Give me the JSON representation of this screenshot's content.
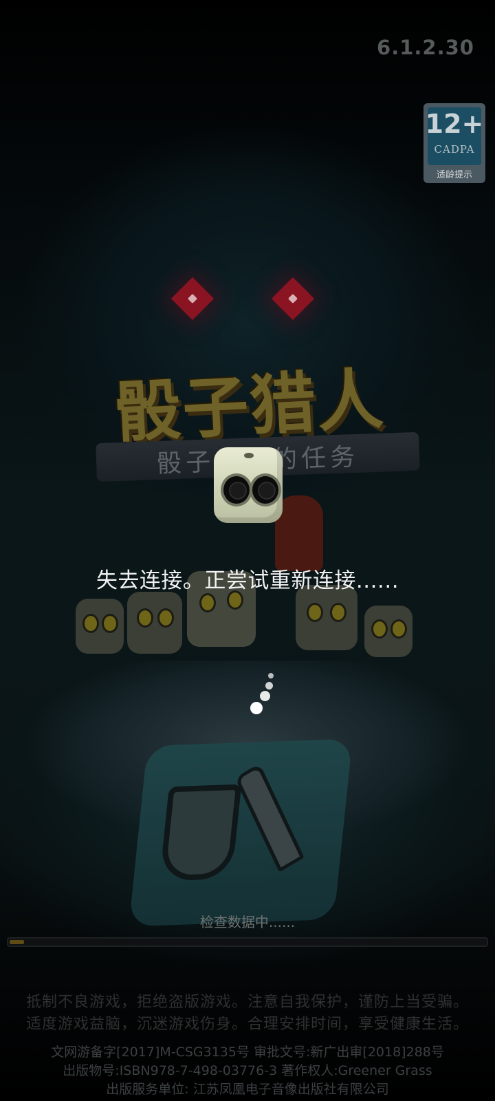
{
  "version": "6.1.2.30",
  "age_rating": {
    "label": "12+",
    "org": "CADPA",
    "tip": "适龄提示"
  },
  "logo": {
    "title": "骰子猎人",
    "subtitle": "骰子使者的任务"
  },
  "status": {
    "reconnect_message": "失去连接。正尝试重新连接......",
    "checking_data": "检查数据中......",
    "progress": 0.03
  },
  "health_notice": {
    "line1": "抵制不良游戏，拒绝盗版游戏。注意自我保护，谨防上当受骗。",
    "line2": "适度游戏益脑，沉迷游戏伤身。合理安排时间，享受健康生活。"
  },
  "legal": {
    "line1": "文网游备字[2017]M-CSG3135号 审批文号:新广出审[2018]288号",
    "line2": "出版物号:ISBN978-7-498-03776-3 著作权人:Greener Grass",
    "line3": "出版服务单位: 江苏凤凰电子音像出版社有限公司"
  },
  "colors": {
    "accent_gold": "#6e6228",
    "monster_eye": "#8a1422",
    "progress_fill": "#5e4c16"
  },
  "icons": {
    "loading": "dice-icon",
    "spinner": "spinner-icon"
  }
}
